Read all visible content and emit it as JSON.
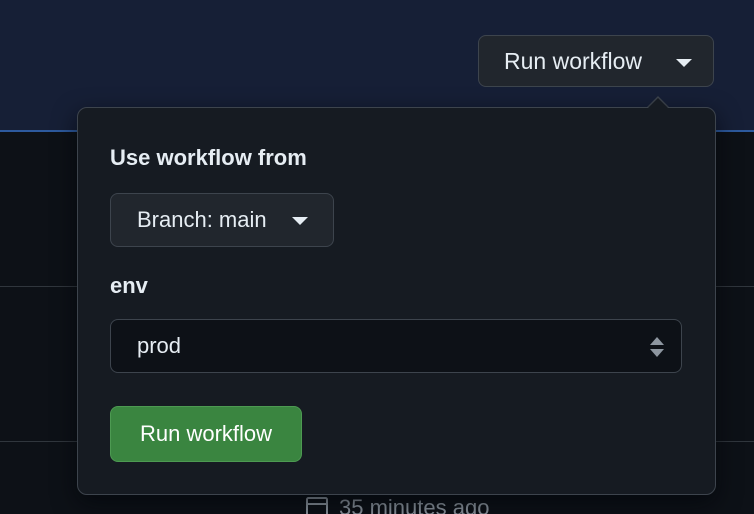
{
  "header": {
    "run_workflow_label": "Run workflow"
  },
  "popover": {
    "title": "Use workflow from",
    "branch_select_label": "Branch: main",
    "env_label": "env",
    "env_value": "prod",
    "submit_label": "Run workflow"
  },
  "footer": {
    "timestamp": "35 minutes ago"
  },
  "icons": {
    "trigger_caret": "chevron-down-icon",
    "branch_caret": "chevron-down-icon",
    "env_stepper": "select-updown-icon",
    "timestamp": "calendar-icon"
  },
  "colors": {
    "header_bg": "#161f36",
    "page_bg": "#0d1117",
    "popover_bg": "#161b22",
    "button_bg": "#21262d",
    "border": "#3d444d",
    "primary_green": "#3a8540",
    "text": "#e6edf3",
    "muted_text": "#8d96a0"
  }
}
